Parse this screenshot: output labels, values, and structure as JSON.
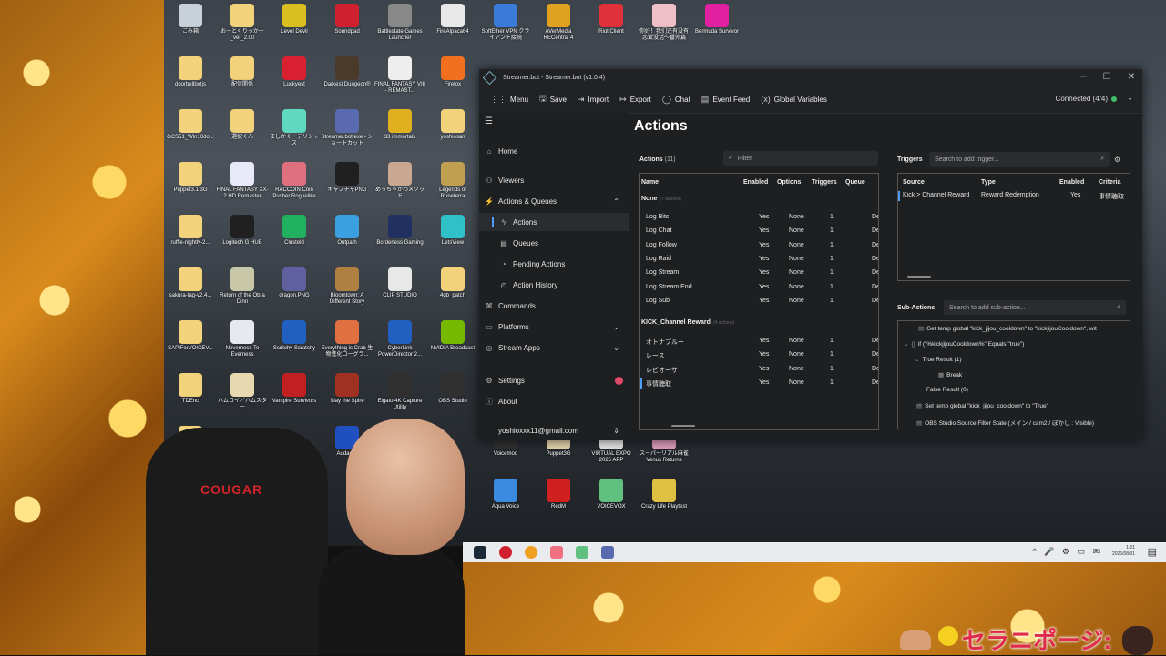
{
  "desktop": {
    "icons": [
      {
        "label": "ごみ箱",
        "color": "#c8d0d8"
      },
      {
        "label": "おーとくりっかー_ver_2.00",
        "color": "#f2d27a"
      },
      {
        "label": "Level Devil",
        "color": "#d9c020"
      },
      {
        "label": "Soundpad",
        "color": "#d02030"
      },
      {
        "label": "Battlestate Games Launcher",
        "color": "#888888"
      },
      {
        "label": "FireAlpaca64",
        "color": "#e8e8e8"
      },
      {
        "label": "SoftEther VPN クライアント接続",
        "color": "#3a7ad8"
      },
      {
        "label": "AVerMedia RECentral 4",
        "color": "#e0a020"
      },
      {
        "label": "Riot Client",
        "color": "#e0303a"
      },
      {
        "label": "你好！我们还有没有恋爱没话～番外篇",
        "color": "#f0c0c8"
      },
      {
        "label": "Bermuda Survivor",
        "color": "#e020a0"
      },
      {
        "label": "doorbellbotjs",
        "color": "#f2d27a"
      },
      {
        "label": "配信関係",
        "color": "#f2d27a"
      },
      {
        "label": "Luckyest",
        "color": "#d82030"
      },
      {
        "label": "Darkest Dungeon®",
        "color": "#4a3a2a"
      },
      {
        "label": "FINAL FANTASY VIII - REMAST...",
        "color": "#eeeeee"
      },
      {
        "label": "Firefox",
        "color": "#f07020"
      },
      {
        "label": "GCS51_Win10do...",
        "color": "#f2d27a"
      },
      {
        "label": "選択くん",
        "color": "#f2d27a"
      },
      {
        "label": "ましかく・デリシャス",
        "color": "#60d8c0"
      },
      {
        "label": "Streamer.bot.exe - ショートカット",
        "color": "#5a6ab0"
      },
      {
        "label": "33 immortals",
        "color": "#e0b020"
      },
      {
        "label": "yoshiosan",
        "color": "#f2d27a"
      },
      {
        "label": "Puppet3.1.3G",
        "color": "#f2d27a"
      },
      {
        "label": "FINAL FANTASY XX-2 HD Remaster",
        "color": "#e8e8f8"
      },
      {
        "label": "RACCOIN Coin Pusher Roguelike",
        "color": "#e07080"
      },
      {
        "label": "キャプチャPNG",
        "color": "#202020"
      },
      {
        "label": "めっちゃかわメソッド",
        "color": "#c8a890"
      },
      {
        "label": "Legends of Runeterra",
        "color": "#c0a050"
      },
      {
        "label": "ruffle-nightly-2...",
        "color": "#f2d27a"
      },
      {
        "label": "Logitech G HUB",
        "color": "#202020"
      },
      {
        "label": "Clusteld",
        "color": "#20b060"
      },
      {
        "label": "Outpath",
        "color": "#3aa0e0"
      },
      {
        "label": "Borderless Gaming",
        "color": "#203060"
      },
      {
        "label": "LetsView",
        "color": "#30c0c8"
      },
      {
        "label": "sakura-tag-v2.4...",
        "color": "#f2d27a"
      },
      {
        "label": "Return of the Obra Dinn",
        "color": "#c8c8a8"
      },
      {
        "label": "dragon.PNG",
        "color": "#6060a0"
      },
      {
        "label": "Bloomtown: A Different Story",
        "color": "#b08040"
      },
      {
        "label": "CLIP STUDIO",
        "color": "#e8e8e8"
      },
      {
        "label": "4gb_patch",
        "color": "#f2d27a"
      },
      {
        "label": "SAPIForVOICEV...",
        "color": "#f2d27a"
      },
      {
        "label": "Neverness To Everness",
        "color": "#e8e8f0"
      },
      {
        "label": "Scritchy Scratchy",
        "color": "#2060c0"
      },
      {
        "label": "Everything is Crab 生物進化ローグラ...",
        "color": "#e07040"
      },
      {
        "label": "CyberLink PowerDirector 2...",
        "color": "#2060c0"
      },
      {
        "label": "NVIDIA Broadcast",
        "color": "#76b900"
      },
      {
        "label": "TDEnc",
        "color": "#f2d27a"
      },
      {
        "label": "ハムコイ／ハムスター",
        "color": "#e8d8b0"
      },
      {
        "label": "Vampire Survivors",
        "color": "#c02020"
      },
      {
        "label": "Slay the Spire",
        "color": "#a03020"
      },
      {
        "label": "Elgato 4K Capture Utility",
        "color": "#303030"
      },
      {
        "label": "OBS Studio",
        "color": "#303030"
      },
      {
        "label": "VRM Dance MV Capture",
        "color": "#f2d27a"
      },
      {
        "label": "Audacity",
        "color": "#2050c0"
      },
      {
        "label": "Voicemod",
        "color": "#303030"
      },
      {
        "label": "Puppet3G",
        "color": "#e8d8b0"
      },
      {
        "label": "VIRTUAL EXPO 2025 APP",
        "color": "#e8e8e8"
      },
      {
        "label": "スーパーリアル麻雀 Venus Returns",
        "color": "#e0a0c0"
      },
      {
        "label": "Aqua Voice",
        "color": "#3a8ae0"
      },
      {
        "label": "RedM",
        "color": "#d02020"
      },
      {
        "label": "VOICEVOX",
        "color": "#60c080"
      },
      {
        "label": "Crazy Life Playtest",
        "color": "#e0c040"
      }
    ]
  },
  "window": {
    "title": "Streamer.bot - Streamer.bot (v1.0.4)",
    "controls": {
      "minimize": "─",
      "maximize": "☐",
      "close": "✕"
    }
  },
  "toolbar": {
    "menu": "Menu",
    "save": "Save",
    "import": "Import",
    "export": "Export",
    "chat": "Chat",
    "event_feed": "Event Feed",
    "global_variables": "Global Variables",
    "connection": "Connected (4/4)"
  },
  "sidebar": {
    "home": "Home",
    "viewers": "Viewers",
    "actions_queues": "Actions & Queues",
    "actions": "Actions",
    "queues": "Queues",
    "pending_actions": "Pending Actions",
    "action_history": "Action History",
    "commands": "Commands",
    "platforms": "Platforms",
    "stream_apps": "Stream Apps",
    "settings": "Settings",
    "about": "About",
    "account": "yoshioxxx11@gmail.com"
  },
  "actions_page": {
    "title": "Actions",
    "panel_label": "Actions",
    "panel_count": "(11)",
    "filter_placeholder": "Filter",
    "columns": {
      "name": "Name",
      "enabled": "Enabled",
      "options": "Options",
      "triggers": "Triggers",
      "queue": "Queue"
    },
    "groups": [
      {
        "name": "None",
        "count": "(7 actions)",
        "rows": [
          {
            "name": "Log Bits",
            "enabled": "Yes",
            "options": "None",
            "triggers": "1",
            "queue": "De"
          },
          {
            "name": "Log Chat",
            "enabled": "Yes",
            "options": "None",
            "triggers": "1",
            "queue": "De"
          },
          {
            "name": "Log Follow",
            "enabled": "Yes",
            "options": "None",
            "triggers": "1",
            "queue": "De"
          },
          {
            "name": "Log Raid",
            "enabled": "Yes",
            "options": "None",
            "triggers": "1",
            "queue": "De"
          },
          {
            "name": "Log Stream",
            "enabled": "Yes",
            "options": "None",
            "triggers": "1",
            "queue": "De"
          },
          {
            "name": "Log Stream End",
            "enabled": "Yes",
            "options": "None",
            "triggers": "1",
            "queue": "De"
          },
          {
            "name": "Log Sub",
            "enabled": "Yes",
            "options": "None",
            "triggers": "1",
            "queue": "De"
          }
        ]
      },
      {
        "name": "KICK_Channel Reward",
        "count": "(4 actions)",
        "rows": [
          {
            "name": "オトナブルー",
            "enabled": "Yes",
            "options": "None",
            "triggers": "1",
            "queue": "De"
          },
          {
            "name": "レース",
            "enabled": "Yes",
            "options": "None",
            "triggers": "1",
            "queue": "De"
          },
          {
            "name": "レビオーサ",
            "enabled": "Yes",
            "options": "None",
            "triggers": "1",
            "queue": "De"
          },
          {
            "name": "事情聴取",
            "enabled": "Yes",
            "options": "None",
            "triggers": "1",
            "queue": "De"
          }
        ]
      }
    ]
  },
  "triggers": {
    "label": "Triggers",
    "search_placeholder": "Search to add trigger...",
    "columns": {
      "source": "Source",
      "type": "Type",
      "enabled": "Enabled",
      "criteria": "Criteria"
    },
    "rows": [
      {
        "source": "Kick > Channel Reward",
        "type": "Reward Redemption",
        "enabled": "Yes",
        "criteria": "事情聴取"
      }
    ]
  },
  "subactions": {
    "label": "Sub-Actions",
    "search_placeholder": "Search to add sub-action...",
    "lines": [
      "Get temp global \"kick_jijou_cooldown\" to \"kickjijouCooldown\", wit",
      "if (\"%kickjijouCooldown%\" Equals \"true\")",
      "True Result (1)",
      "Break",
      "False Result (0)",
      "Set temp global \"kick_jijou_cooldown\" to \"True\"",
      "OBS Studio Source Filter State (メイン / cam2 / ぼかし : Visible)"
    ]
  },
  "taskbar": {
    "time": "1:21",
    "date": "2026/08/31"
  },
  "overlay": {
    "text": "セラニポージ:"
  },
  "person": {
    "chair_brand": "COUGAR"
  }
}
